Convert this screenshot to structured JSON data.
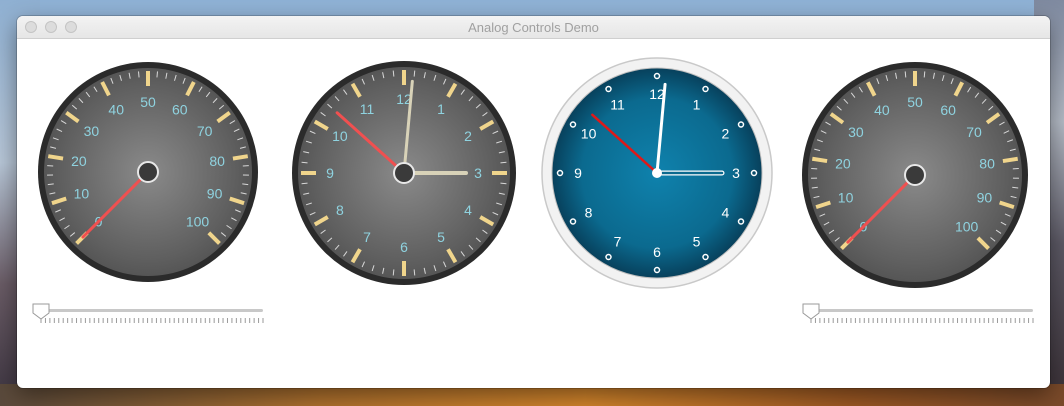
{
  "window": {
    "title": "Analog Controls Demo"
  },
  "gauge_left": {
    "labels": [
      "0",
      "10",
      "20",
      "30",
      "40",
      "50",
      "60",
      "70",
      "80",
      "90",
      "100"
    ],
    "value": 0
  },
  "clock_dark": {
    "numbers": [
      "12",
      "1",
      "2",
      "3",
      "4",
      "5",
      "6",
      "7",
      "8",
      "9",
      "10",
      "11"
    ],
    "time": "3:00:52"
  },
  "clock_blue": {
    "numbers": [
      "12",
      "1",
      "2",
      "3",
      "4",
      "5",
      "6",
      "7",
      "8",
      "9",
      "10",
      "11"
    ],
    "time": "3:00:52"
  },
  "gauge_right": {
    "labels": [
      "0",
      "10",
      "20",
      "30",
      "40",
      "50",
      "60",
      "70",
      "80",
      "90",
      "100"
    ],
    "value": 0
  },
  "slider_left": {
    "value": 0
  },
  "slider_right": {
    "value": 0
  },
  "colors": {
    "dial_dark": "#5e5e5e",
    "dial_rim": "#2b2b2b",
    "tick_major": "#f0d58c",
    "label_text": "#8fd3e0",
    "needle": "#f05050",
    "clock_hand": "#d8d2b8",
    "blue_face": "#0b6a8f",
    "blue_hand": "#ffffff"
  }
}
